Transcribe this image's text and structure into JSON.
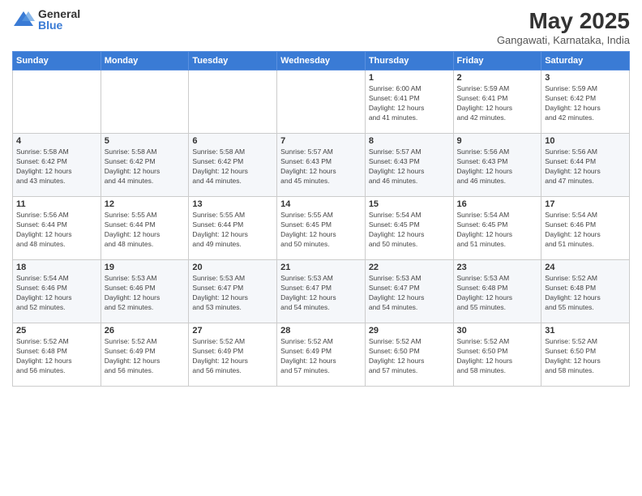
{
  "logo": {
    "general": "General",
    "blue": "Blue"
  },
  "title": "May 2025",
  "location": "Gangawati, Karnataka, India",
  "days_of_week": [
    "Sunday",
    "Monday",
    "Tuesday",
    "Wednesday",
    "Thursday",
    "Friday",
    "Saturday"
  ],
  "weeks": [
    [
      {
        "day": "",
        "info": ""
      },
      {
        "day": "",
        "info": ""
      },
      {
        "day": "",
        "info": ""
      },
      {
        "day": "",
        "info": ""
      },
      {
        "day": "1",
        "info": "Sunrise: 6:00 AM\nSunset: 6:41 PM\nDaylight: 12 hours\nand 41 minutes."
      },
      {
        "day": "2",
        "info": "Sunrise: 5:59 AM\nSunset: 6:41 PM\nDaylight: 12 hours\nand 42 minutes."
      },
      {
        "day": "3",
        "info": "Sunrise: 5:59 AM\nSunset: 6:42 PM\nDaylight: 12 hours\nand 42 minutes."
      }
    ],
    [
      {
        "day": "4",
        "info": "Sunrise: 5:58 AM\nSunset: 6:42 PM\nDaylight: 12 hours\nand 43 minutes."
      },
      {
        "day": "5",
        "info": "Sunrise: 5:58 AM\nSunset: 6:42 PM\nDaylight: 12 hours\nand 44 minutes."
      },
      {
        "day": "6",
        "info": "Sunrise: 5:58 AM\nSunset: 6:42 PM\nDaylight: 12 hours\nand 44 minutes."
      },
      {
        "day": "7",
        "info": "Sunrise: 5:57 AM\nSunset: 6:43 PM\nDaylight: 12 hours\nand 45 minutes."
      },
      {
        "day": "8",
        "info": "Sunrise: 5:57 AM\nSunset: 6:43 PM\nDaylight: 12 hours\nand 46 minutes."
      },
      {
        "day": "9",
        "info": "Sunrise: 5:56 AM\nSunset: 6:43 PM\nDaylight: 12 hours\nand 46 minutes."
      },
      {
        "day": "10",
        "info": "Sunrise: 5:56 AM\nSunset: 6:44 PM\nDaylight: 12 hours\nand 47 minutes."
      }
    ],
    [
      {
        "day": "11",
        "info": "Sunrise: 5:56 AM\nSunset: 6:44 PM\nDaylight: 12 hours\nand 48 minutes."
      },
      {
        "day": "12",
        "info": "Sunrise: 5:55 AM\nSunset: 6:44 PM\nDaylight: 12 hours\nand 48 minutes."
      },
      {
        "day": "13",
        "info": "Sunrise: 5:55 AM\nSunset: 6:44 PM\nDaylight: 12 hours\nand 49 minutes."
      },
      {
        "day": "14",
        "info": "Sunrise: 5:55 AM\nSunset: 6:45 PM\nDaylight: 12 hours\nand 50 minutes."
      },
      {
        "day": "15",
        "info": "Sunrise: 5:54 AM\nSunset: 6:45 PM\nDaylight: 12 hours\nand 50 minutes."
      },
      {
        "day": "16",
        "info": "Sunrise: 5:54 AM\nSunset: 6:45 PM\nDaylight: 12 hours\nand 51 minutes."
      },
      {
        "day": "17",
        "info": "Sunrise: 5:54 AM\nSunset: 6:46 PM\nDaylight: 12 hours\nand 51 minutes."
      }
    ],
    [
      {
        "day": "18",
        "info": "Sunrise: 5:54 AM\nSunset: 6:46 PM\nDaylight: 12 hours\nand 52 minutes."
      },
      {
        "day": "19",
        "info": "Sunrise: 5:53 AM\nSunset: 6:46 PM\nDaylight: 12 hours\nand 52 minutes."
      },
      {
        "day": "20",
        "info": "Sunrise: 5:53 AM\nSunset: 6:47 PM\nDaylight: 12 hours\nand 53 minutes."
      },
      {
        "day": "21",
        "info": "Sunrise: 5:53 AM\nSunset: 6:47 PM\nDaylight: 12 hours\nand 54 minutes."
      },
      {
        "day": "22",
        "info": "Sunrise: 5:53 AM\nSunset: 6:47 PM\nDaylight: 12 hours\nand 54 minutes."
      },
      {
        "day": "23",
        "info": "Sunrise: 5:53 AM\nSunset: 6:48 PM\nDaylight: 12 hours\nand 55 minutes."
      },
      {
        "day": "24",
        "info": "Sunrise: 5:52 AM\nSunset: 6:48 PM\nDaylight: 12 hours\nand 55 minutes."
      }
    ],
    [
      {
        "day": "25",
        "info": "Sunrise: 5:52 AM\nSunset: 6:48 PM\nDaylight: 12 hours\nand 56 minutes."
      },
      {
        "day": "26",
        "info": "Sunrise: 5:52 AM\nSunset: 6:49 PM\nDaylight: 12 hours\nand 56 minutes."
      },
      {
        "day": "27",
        "info": "Sunrise: 5:52 AM\nSunset: 6:49 PM\nDaylight: 12 hours\nand 56 minutes."
      },
      {
        "day": "28",
        "info": "Sunrise: 5:52 AM\nSunset: 6:49 PM\nDaylight: 12 hours\nand 57 minutes."
      },
      {
        "day": "29",
        "info": "Sunrise: 5:52 AM\nSunset: 6:50 PM\nDaylight: 12 hours\nand 57 minutes."
      },
      {
        "day": "30",
        "info": "Sunrise: 5:52 AM\nSunset: 6:50 PM\nDaylight: 12 hours\nand 58 minutes."
      },
      {
        "day": "31",
        "info": "Sunrise: 5:52 AM\nSunset: 6:50 PM\nDaylight: 12 hours\nand 58 minutes."
      }
    ]
  ]
}
